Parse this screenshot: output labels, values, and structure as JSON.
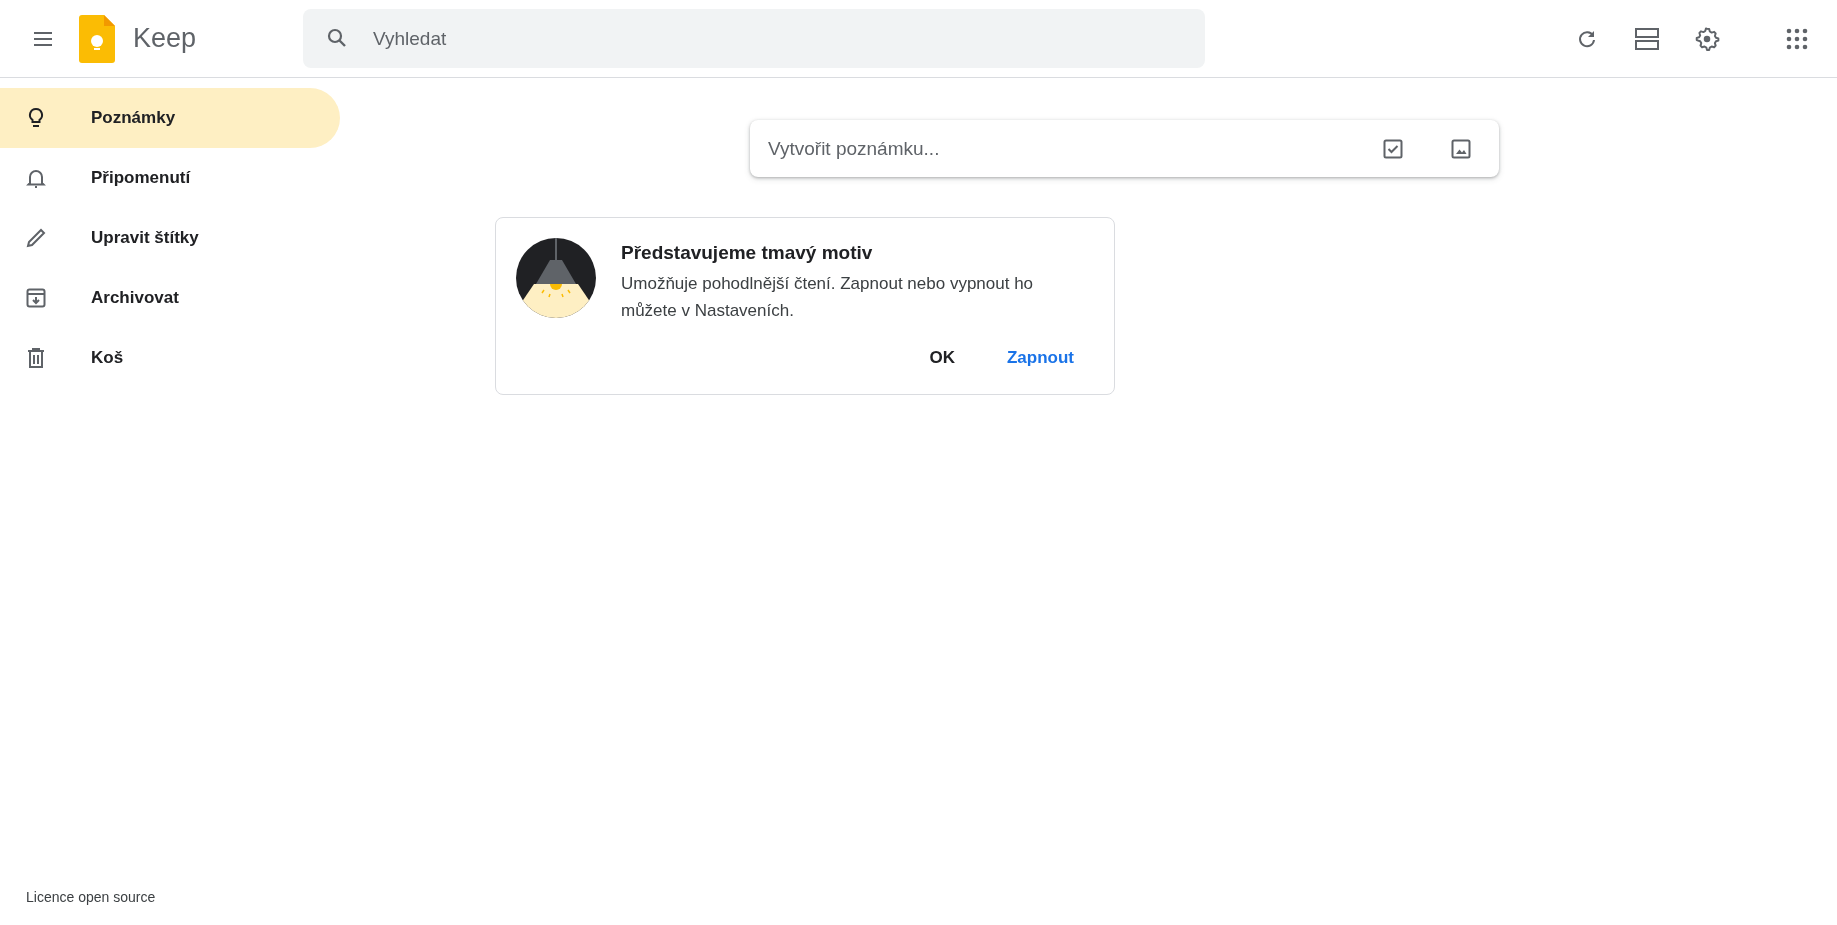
{
  "header": {
    "app_name": "Keep",
    "search": {
      "placeholder": "Vyhledat"
    }
  },
  "sidebar": {
    "items": [
      {
        "kind": "bulb",
        "label": "Poznámky",
        "selected": true
      },
      {
        "kind": "bell",
        "label": "Připomenutí",
        "selected": false
      },
      {
        "kind": "pencil",
        "label": "Upravit štítky",
        "selected": false
      },
      {
        "kind": "archive",
        "label": "Archivovat",
        "selected": false
      },
      {
        "kind": "trash",
        "label": "Koš",
        "selected": false
      }
    ],
    "footer_link": "Licence open source"
  },
  "note_input": {
    "placeholder": "Vytvořit poznámku..."
  },
  "promo_card": {
    "title": "Představujeme tmavý motiv",
    "body": "Umožňuje pohodlnější čtení. Zapnout nebo vypnout ho můžete v Nastaveních.",
    "buttons": [
      {
        "label": "OK",
        "kind": "plain"
      },
      {
        "label": "Zapnout",
        "kind": "accent"
      }
    ]
  }
}
